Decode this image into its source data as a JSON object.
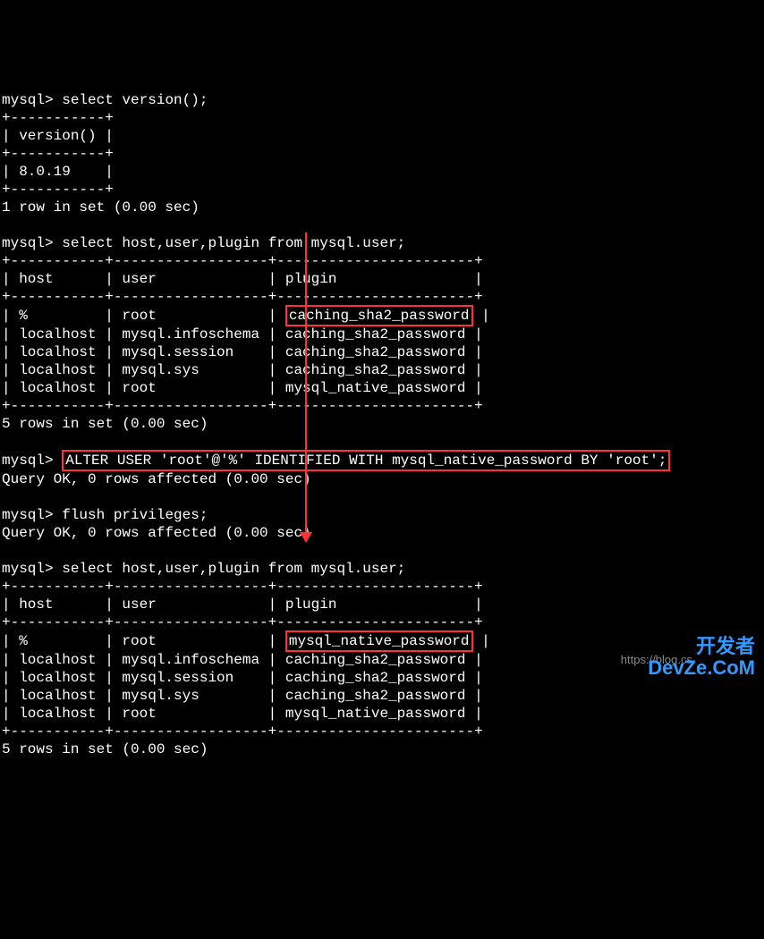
{
  "prompt": "mysql>",
  "cmd1": "select version();",
  "table1": {
    "border_top": "+-----------+",
    "header": "| version() |",
    "border_mid": "+-----------+",
    "row1": "| 8.0.19    |",
    "border_bot": "+-----------+"
  },
  "result1": "1 row in set (0.00 sec)",
  "cmd2": "select host,user,plugin from mysql.user;",
  "table2": {
    "border": "+-----------+------------------+-----------------------+",
    "header": "| host      | user             | plugin                |",
    "row1_pre": "| %         | root             | ",
    "row1_hl": "caching_sha2_password",
    "row1_post": " |",
    "row2": "| localhost | mysql.infoschema | caching_sha2_password |",
    "row3": "| localhost | mysql.session    | caching_sha2_password |",
    "row4": "| localhost | mysql.sys        | caching_sha2_password |",
    "row5": "| localhost | root             | mysql_native_password |"
  },
  "result2": "5 rows in set (0.00 sec)",
  "cmd3": "ALTER USER 'root'@'%' IDENTIFIED WITH mysql_native_password BY 'root';",
  "result3": "Query OK, 0 rows affected (0.00 sec)",
  "cmd4": "flush privileges;",
  "result4": "Query OK, 0 rows affected (0.00 sec)",
  "cmd5": "select host,user,plugin from mysql.user;",
  "table3": {
    "border": "+-----------+------------------+-----------------------+",
    "header": "| host      | user             | plugin                |",
    "row1_pre": "| %         | root             | ",
    "row1_hl": "mysql_native_password",
    "row1_post": " |",
    "row2": "| localhost | mysql.infoschema | caching_sha2_password |",
    "row3": "| localhost | mysql.session    | caching_sha2_password |",
    "row4": "| localhost | mysql.sys        | caching_sha2_password |",
    "row5": "| localhost | root             | mysql_native_password |"
  },
  "result5": "5 rows in set (0.00 sec)",
  "watermark": {
    "url": "https://blog.cs",
    "logo_line1": "开发者",
    "logo_line2": "DevZe.CoM"
  }
}
